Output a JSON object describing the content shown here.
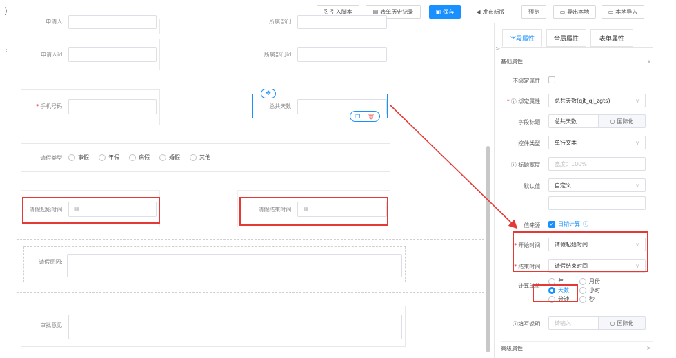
{
  "toolbar": {
    "import_script": "引入脚本",
    "history": "表单历史记录",
    "save": "保存",
    "publish": "发布新版",
    "preview": "预览",
    "export_local": "导出本地",
    "import_local": "本地导入"
  },
  "form": {
    "applicant_label": "申请人:",
    "department_label": "所属部门:",
    "applicant_id_label": "申请人id:",
    "department_id_label": "所属部门id:",
    "phone_label": "手机号码:",
    "total_days_label": "总共天数:",
    "leave_type_label": "请假类型:",
    "leave_types": [
      "事假",
      "年假",
      "病假",
      "婚假",
      "其他"
    ],
    "start_time_label": "请假起始时间:",
    "end_time_label": "请假结束时间:",
    "reason_label": "请假原因:",
    "opinion_label": "审批意见:"
  },
  "panel": {
    "tabs": [
      "字段属性",
      "全局属性",
      "表单属性"
    ],
    "section_basic": "基础属性",
    "unbind_label": "不绑定属性:",
    "bind_label": "绑定属性:",
    "bind_value": "总共天数(qjt_qj_zgts)",
    "field_title_label": "字段标题:",
    "field_title_value": "总共天数",
    "intl_label": "国际化",
    "control_type_label": "控件类型:",
    "control_type_value": "单行文本",
    "title_width_label": "标题宽度:",
    "title_width_placeholder": "宽度：100%",
    "default_label": "默认值:",
    "default_value": "自定义",
    "value_source_label": "值来源:",
    "value_source_value": "日期计算",
    "start_label": "开始时间:",
    "start_value": "请假起始时间",
    "end_label": "结束时间:",
    "end_value": "请假结束时间",
    "calc_unit_label": "计算单位:",
    "units": [
      "年",
      "月份",
      "天数",
      "小时",
      "分钟",
      "秒"
    ],
    "fill_note_label": "填写说明:",
    "fill_note_placeholder": "请输入",
    "section_advanced": "高级属性"
  },
  "colors": {
    "primary": "#1890ff",
    "annotation": "#e53935"
  }
}
